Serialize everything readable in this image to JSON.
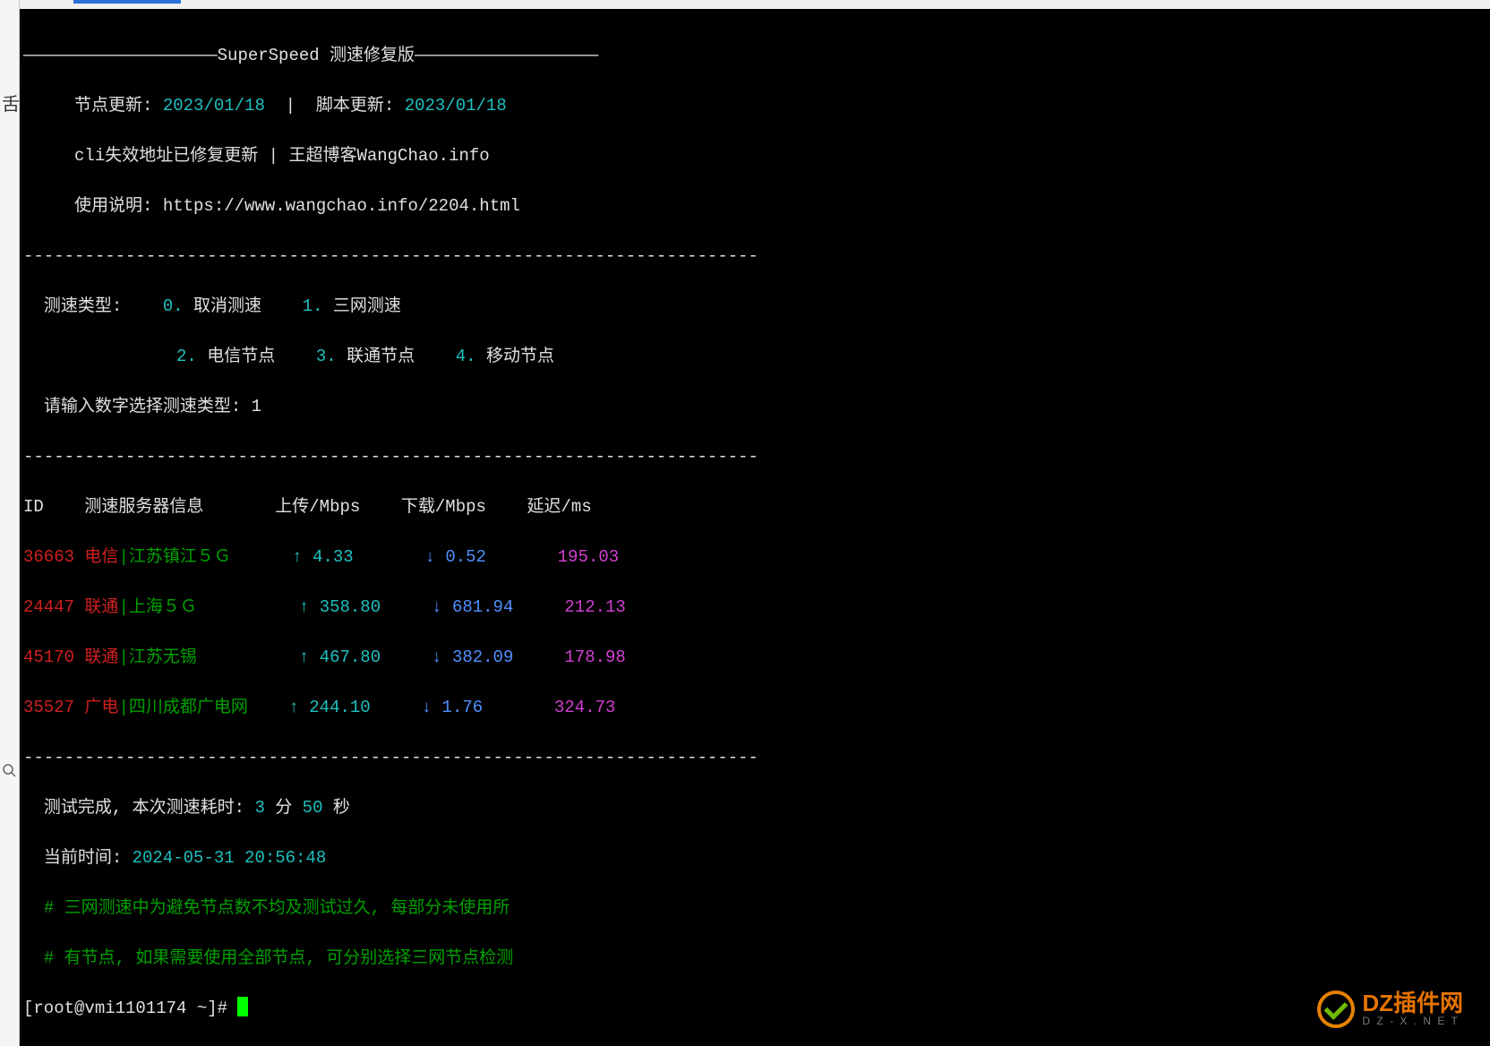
{
  "left_char": "舌",
  "header": {
    "title": "SuperSpeed 测速修复版",
    "node_update_label": "节点更新:",
    "node_update": "2023/01/18",
    "sep1": "|",
    "script_update_label": "脚本更新:",
    "script_update": "2023/01/18",
    "cli_fixed": "cli失效地址已修复更新",
    "sep2": "|",
    "blog": "王超博客WangChao.info",
    "manual_label": "使用说明:",
    "manual_url": "https://www.wangchao.info/2204.html"
  },
  "menu": {
    "type_label": "测速类型:",
    "opt0_num": "0.",
    "opt0": "取消测速",
    "opt1_num": "1.",
    "opt1": "三网测速",
    "opt2_num": "2.",
    "opt2": "电信节点",
    "opt3_num": "3.",
    "opt3": "联通节点",
    "opt4_num": "4.",
    "opt4": "移动节点",
    "prompt": "请输入数字选择测速类型:",
    "input": "1"
  },
  "table": {
    "h_id": "ID",
    "h_server": "测速服务器信息",
    "h_upload": "上传/Mbps",
    "h_download": "下载/Mbps",
    "h_latency": "延迟/ms",
    "rows": [
      {
        "id": "36663",
        "isp": "电信",
        "loc": "江苏镇江５Ｇ",
        "up": "4.33",
        "down": "0.52",
        "lat": "195.03"
      },
      {
        "id": "24447",
        "isp": "联通",
        "loc": "上海５Ｇ",
        "up": "358.80",
        "down": "681.94",
        "lat": "212.13"
      },
      {
        "id": "45170",
        "isp": "联通",
        "loc": "江苏无锡",
        "up": "467.80",
        "down": "382.09",
        "lat": "178.98"
      },
      {
        "id": "35527",
        "isp": "广电",
        "loc": "四川成都广电网",
        "up": "244.10",
        "down": "1.76",
        "lat": "324.73"
      }
    ]
  },
  "arrows": {
    "up": "↑",
    "down": "↓"
  },
  "footer": {
    "complete_prefix": "测试完成, 本次测速耗时:",
    "min": "3",
    "min_unit": "分",
    "sec": "50",
    "sec_unit": "秒",
    "time_label": "当前时间:",
    "time": "2024-05-31 20:56:48",
    "note1": "# 三网测速中为避免节点数不均及测试过久, 每部分未使用所",
    "note2": "# 有节点, 如果需要使用全部节点, 可分别选择三网节点检测"
  },
  "prompt": {
    "full": "[root@vmi1101174 ~]#"
  },
  "watermark": {
    "text": "DZ插件网",
    "sub": "D Z - X . N E T"
  }
}
